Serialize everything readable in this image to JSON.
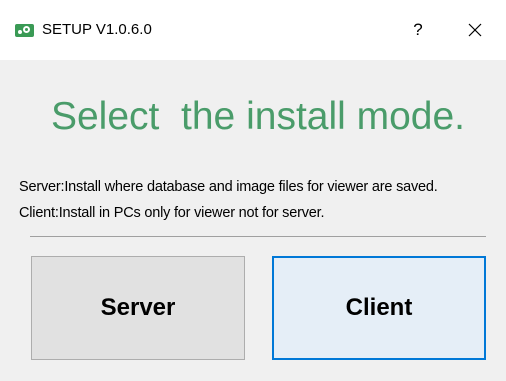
{
  "window": {
    "title": "SETUP V1.0.6.0",
    "help_label": "?",
    "icons": {
      "app": "setup-app-icon",
      "close": "close-icon"
    }
  },
  "main": {
    "headline": "Select  the install mode.",
    "server_description": "Server:Install where database and image files for viewer are saved.",
    "client_description": "Client:Install in PCs only for viewer not for server."
  },
  "buttons": {
    "server_label": "Server",
    "client_label": "Client"
  },
  "colors": {
    "headline": "#4a9c6a",
    "focus_border": "#0078d7",
    "app_icon": "#3a9a55"
  }
}
